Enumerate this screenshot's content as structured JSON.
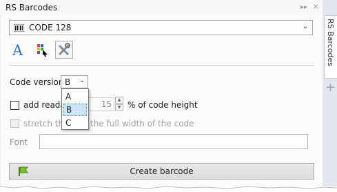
{
  "panel": {
    "title": "RS Barcodes",
    "pin_glyph": "▸▸",
    "close_glyph": "✕"
  },
  "barcode_type": {
    "selected": "CODE 128",
    "icon": "barcode-icon"
  },
  "toolbar": {
    "tools": [
      {
        "name": "text-format-tool",
        "icon": "letter-a-icon"
      },
      {
        "name": "color-tool",
        "icon": "color-palette-icon"
      },
      {
        "name": "settings-tool",
        "icon": "tools-icon",
        "selected": true
      }
    ]
  },
  "code_version": {
    "label": "Code version",
    "selected": "B",
    "options": [
      "A",
      "B",
      "C"
    ],
    "highlighted": "B"
  },
  "readable_text": {
    "label": "add reada",
    "checked": false,
    "value": "15",
    "suffix": "% of code height"
  },
  "stretch": {
    "label_start": "stretch the",
    "label_end": "the full width of the code",
    "checked": false,
    "disabled": true
  },
  "font": {
    "label": "Font",
    "value": ""
  },
  "create_button": {
    "label": "Create barcode",
    "icon": "flag-icon"
  },
  "sidebar": {
    "tab_label": "RS Barcodes",
    "add_glyph": "+"
  },
  "colors": {
    "panel_bg": "#f0f0f0",
    "accent": "#26a0da",
    "highlight": "#cde4f7"
  }
}
